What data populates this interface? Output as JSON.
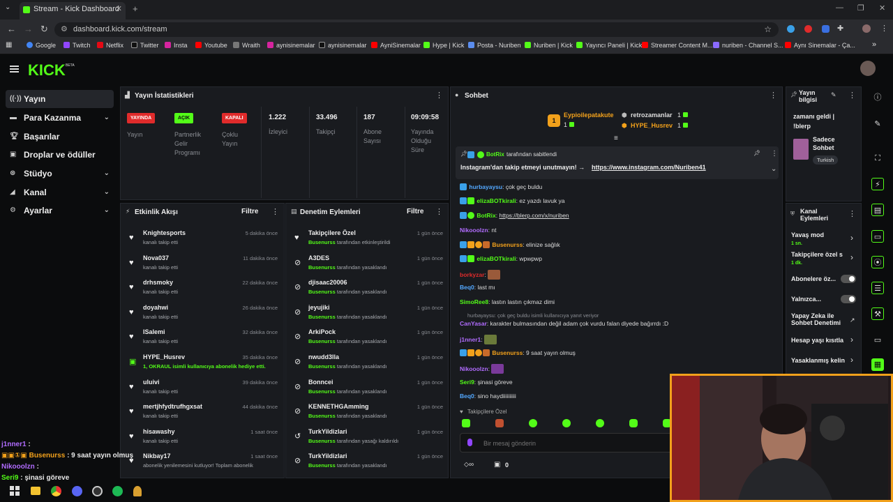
{
  "browser": {
    "tab_title": "Stream - Kick Dashboard",
    "url": "dashboard.kick.com/stream",
    "bookmarks": [
      "Google",
      "Twitch",
      "Netflix",
      "Twitter",
      "Insta",
      "Youtube",
      "Wraith",
      "aynisinemalar",
      "aynisinemalar",
      "AyniSinemalar",
      "Hype | Kick",
      "Posta - Nuriben",
      "Nuriben | Kick",
      "Yayıncı Paneli | Kick",
      "Streamer Content M...",
      "nuriben - Channel S...",
      "Aynı Sinemalar - Ça..."
    ]
  },
  "brand": {
    "logo": "KICK",
    "accent": "#53fc18"
  },
  "sidebar": {
    "items": [
      {
        "label": "Yayın",
        "icon": "broadcast-icon"
      },
      {
        "label": "Para Kazanma",
        "icon": "money-icon"
      },
      {
        "label": "Başarılar",
        "icon": "trophy-icon"
      },
      {
        "label": "Droplar ve ödüller",
        "icon": "gift-icon"
      },
      {
        "label": "Stüdyo",
        "icon": "studio-icon"
      },
      {
        "label": "Kanal",
        "icon": "channel-icon"
      },
      {
        "label": "Ayarlar",
        "icon": "gear-icon"
      }
    ]
  },
  "stats": {
    "title": "Yayın İstatistikleri",
    "badges": [
      {
        "badge": "YAYINDA",
        "label": "Yayın",
        "color": "#e02b2b"
      },
      {
        "badge": "AÇIK",
        "label": "Partnerlik Gelir Programı",
        "color": "#53fc18"
      },
      {
        "badge": "KAPALI",
        "label": "Çoklu Yayın",
        "color": "#e02b2b"
      }
    ],
    "values": [
      {
        "value": "1.222",
        "label": "İzleyici"
      },
      {
        "value": "33.496",
        "label": "Takipçi"
      },
      {
        "value": "187",
        "label": "Abone Sayısı"
      },
      {
        "value": "09:09:58",
        "label": "Yayında Olduğu Süre"
      }
    ]
  },
  "activity": {
    "title": "Etkinlik Akışı",
    "filter": "Filtre",
    "events": [
      {
        "name": "Knightesports",
        "sub": "kanalı takip etti",
        "time": "5 dakika önce"
      },
      {
        "name": "Nova037",
        "sub": "kanalı takip etti",
        "time": "11 dakika önce"
      },
      {
        "name": "drhsmoky",
        "sub": "kanalı takip etti",
        "time": "22 dakika önce"
      },
      {
        "name": "doyahwi",
        "sub": "kanalı takip etti",
        "time": "26 dakika önce"
      },
      {
        "name": "ISalemi",
        "sub": "kanalı takip etti",
        "time": "32 dakika önce"
      },
      {
        "name": "HYPE_Husrev",
        "sub": "1, OKRAUL isimli kullanıcıya abonelik hediye etti.",
        "time": "35 dakika önce"
      },
      {
        "name": "uluivi",
        "sub": "kanalı takip etti",
        "time": "39 dakika önce"
      },
      {
        "name": "mertjhfydtrufhgxsat",
        "sub": "kanalı takip etti",
        "time": "44 dakika önce"
      },
      {
        "name": "hisawashy",
        "sub": "kanalı takip etti",
        "time": "1 saat önce"
      },
      {
        "name": "Nikbay17",
        "sub": "abonelik yenilemesini kutluyor! Toplam abonelik",
        "time": "1 saat önce"
      }
    ]
  },
  "moderation": {
    "title": "Denetim Eylemleri",
    "filter": "Filtre",
    "actions": [
      {
        "name": "Takipçilere Özel",
        "by": "Busenurss",
        "suffix": "tarafından etkinleştirildi",
        "time": "1 gün önce"
      },
      {
        "name": "A3DES",
        "by": "Busenurss",
        "suffix": "tarafından yasaklandı",
        "time": "1 gün önce"
      },
      {
        "name": "djisaac20006",
        "by": "Busenurss",
        "suffix": "tarafından yasaklandı",
        "time": "1 gün önce"
      },
      {
        "name": "jeyujiki",
        "by": "Busenurss",
        "suffix": "tarafından yasaklandı",
        "time": "1 gün önce"
      },
      {
        "name": "ArkiPock",
        "by": "Busenurss",
        "suffix": "tarafından yasaklandı",
        "time": "1 gün önce"
      },
      {
        "name": "nwudd3lla",
        "by": "Busenurss",
        "suffix": "tarafından yasaklandı",
        "time": "1 gün önce"
      },
      {
        "name": "Bonncei",
        "by": "Busenurss",
        "suffix": "tarafından yasaklandı",
        "time": "1 gün önce"
      },
      {
        "name": "KENNETHGAmming",
        "by": "Busenurss",
        "suffix": "tarafından yasaklandı",
        "time": "1 gün önce"
      },
      {
        "name": "TurkYildizlari",
        "by": "Busenurss",
        "suffix": "tarafından yasağı kaldırıldı",
        "time": "1 gün önce"
      },
      {
        "name": "TurkYildizlari",
        "by": "Busenurss",
        "suffix": "tarafından yasaklandı",
        "time": "1 gün önce"
      }
    ]
  },
  "chat": {
    "title": "Sohbet",
    "leaders": [
      {
        "name": "Eypioilepatakute",
        "count": "1"
      },
      {
        "name": "retrozamanlar",
        "count": "1"
      },
      {
        "name": "HYPE_Husrev",
        "count": "1"
      }
    ],
    "pinned": {
      "by": "BotRix",
      "label": "tarafından sabitlendi",
      "text": "Instagram'dan takip etmeyi unutmayın! →",
      "link": "https://www.instagram.com/Nuriben41"
    },
    "messages": [
      {
        "user": "hurbayaysu",
        "color": "#53a8ff",
        "text": "çok geç buldu"
      },
      {
        "user": "elizaBOTkirali",
        "color": "#53fc18",
        "text": "ez yazdı lavuk ya"
      },
      {
        "user": "BotRix",
        "color": "#53fc18",
        "text": "https://blerp.com/x/nuriben"
      },
      {
        "user": "Nikooolzn",
        "color": "#b16cff",
        "text": "nt"
      },
      {
        "user": "Busenurss",
        "color": "#f2a11b",
        "text": "elinize sağlık"
      },
      {
        "user": "elizaBOTkirali",
        "color": "#53fc18",
        "text": "wpwpwp"
      },
      {
        "user": "borkyzar",
        "color": "#e02b2b",
        "text": ""
      },
      {
        "user": "Beq0",
        "color": "#53a8ff",
        "text": "last mı"
      },
      {
        "user": "SimoRee8",
        "color": "#53fc18",
        "text": "lastın lastın çıkmaz dimi"
      },
      {
        "user": "CanYasar",
        "color": "#b16cff",
        "text": "karakter bulmasından değil adam çok vurdu falan diyede bağırrdı :D"
      },
      {
        "user": "j1nner1",
        "color": "#b16cff",
        "text": ""
      },
      {
        "user": "Busenurss",
        "color": "#f2a11b",
        "text": "9 saat yayın olmuş"
      },
      {
        "user": "Nikooolzn",
        "color": "#b16cff",
        "text": ""
      },
      {
        "user": "Seri9",
        "color": "#53fc18",
        "text": "şinasi göreve"
      },
      {
        "user": "Beq0",
        "color": "#53a8ff",
        "text": "sino haydiiiiiiiiii"
      }
    ],
    "reply_note": "hurbayaysu: çok geç buldu isimli kullanıcıya yanıt veriyor",
    "followers_only": "Takipçilere Özel",
    "input_placeholder": "Bir mesaj gönderin",
    "points": "0"
  },
  "stream_info": {
    "title": "Yayın bilgisi",
    "text_line1": "zamanı geldi |",
    "text_line2": "!blerp",
    "category": "Sadece Sohbet",
    "tag": "Turkish"
  },
  "channel_actions": {
    "title": "Kanal Eylemleri",
    "items": [
      {
        "label": "Yavaş mod",
        "sub": "1 sn."
      },
      {
        "label": "Takipçilere özel s",
        "sub": "1 dk."
      },
      {
        "label": "Abonelere öz...",
        "sub": ""
      },
      {
        "label": "Yalnızca...",
        "sub": ""
      },
      {
        "label": "Yapay Zeka ile Sohbet Denetimi",
        "sub": ""
      },
      {
        "label": "Hesap yaşı kısıtla",
        "sub": ""
      },
      {
        "label": "Yasaklanmış kelin",
        "sub": ""
      }
    ]
  },
  "overlay_chat": [
    {
      "user": "j1nner1",
      "text": ":"
    },
    {
      "user": "Busenurss",
      "text": ": 9 saat yayın olmuş"
    },
    {
      "user": "Nikooolzn",
      "text": ":"
    },
    {
      "user": "Seri9",
      "text": ": şinasi göreve"
    }
  ]
}
